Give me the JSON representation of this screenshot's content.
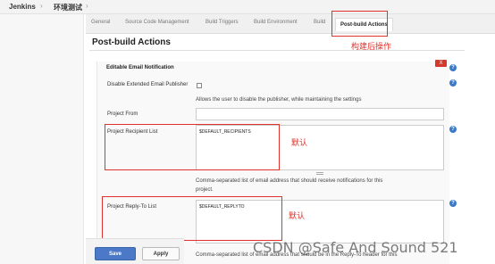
{
  "breadcrumb": {
    "items": [
      "Jenkins",
      "环境测试"
    ],
    "separator": "›"
  },
  "tabs": [
    {
      "label": "General"
    },
    {
      "label": "Source Code Management"
    },
    {
      "label": "Build Triggers"
    },
    {
      "label": "Build Environment"
    },
    {
      "label": "Build"
    },
    {
      "label": "Post-build Actions",
      "active": true
    }
  ],
  "annotations": {
    "tab_note": "构建后操作",
    "recipient_note": "默认",
    "replyto_note": "默认"
  },
  "section": {
    "title": "Post-build Actions"
  },
  "panel": {
    "title": "Editable Email Notification",
    "delete_label": "X",
    "help_label": "?",
    "disable_label": "Disable Extended Email Publisher",
    "disable_desc": "Allows the user to disable the publisher, while maintaining the settings",
    "project_from_label": "Project From",
    "project_from_value": "",
    "recipient_label": "Project Recipient List",
    "recipient_value": "$DEFAULT_RECIPIENTS",
    "recipient_desc_1": "Comma-separated list of email address that should receive notifications for this",
    "recipient_desc_2": "project.",
    "replyto_label": "Project Reply-To List",
    "replyto_value": "$DEFAULT_REPLYTO",
    "replyto_desc": "Comma-separated list of email address that should be in the Reply-To header for this"
  },
  "buttons": {
    "save": "Save",
    "apply": "Apply"
  },
  "watermark": "CSDN @Safe And Sound 521",
  "colors": {
    "accent": "#4b79c7",
    "annotation_red": "#e0322c",
    "delete_red": "#d33a2c",
    "help_blue": "#3a7ac8"
  }
}
